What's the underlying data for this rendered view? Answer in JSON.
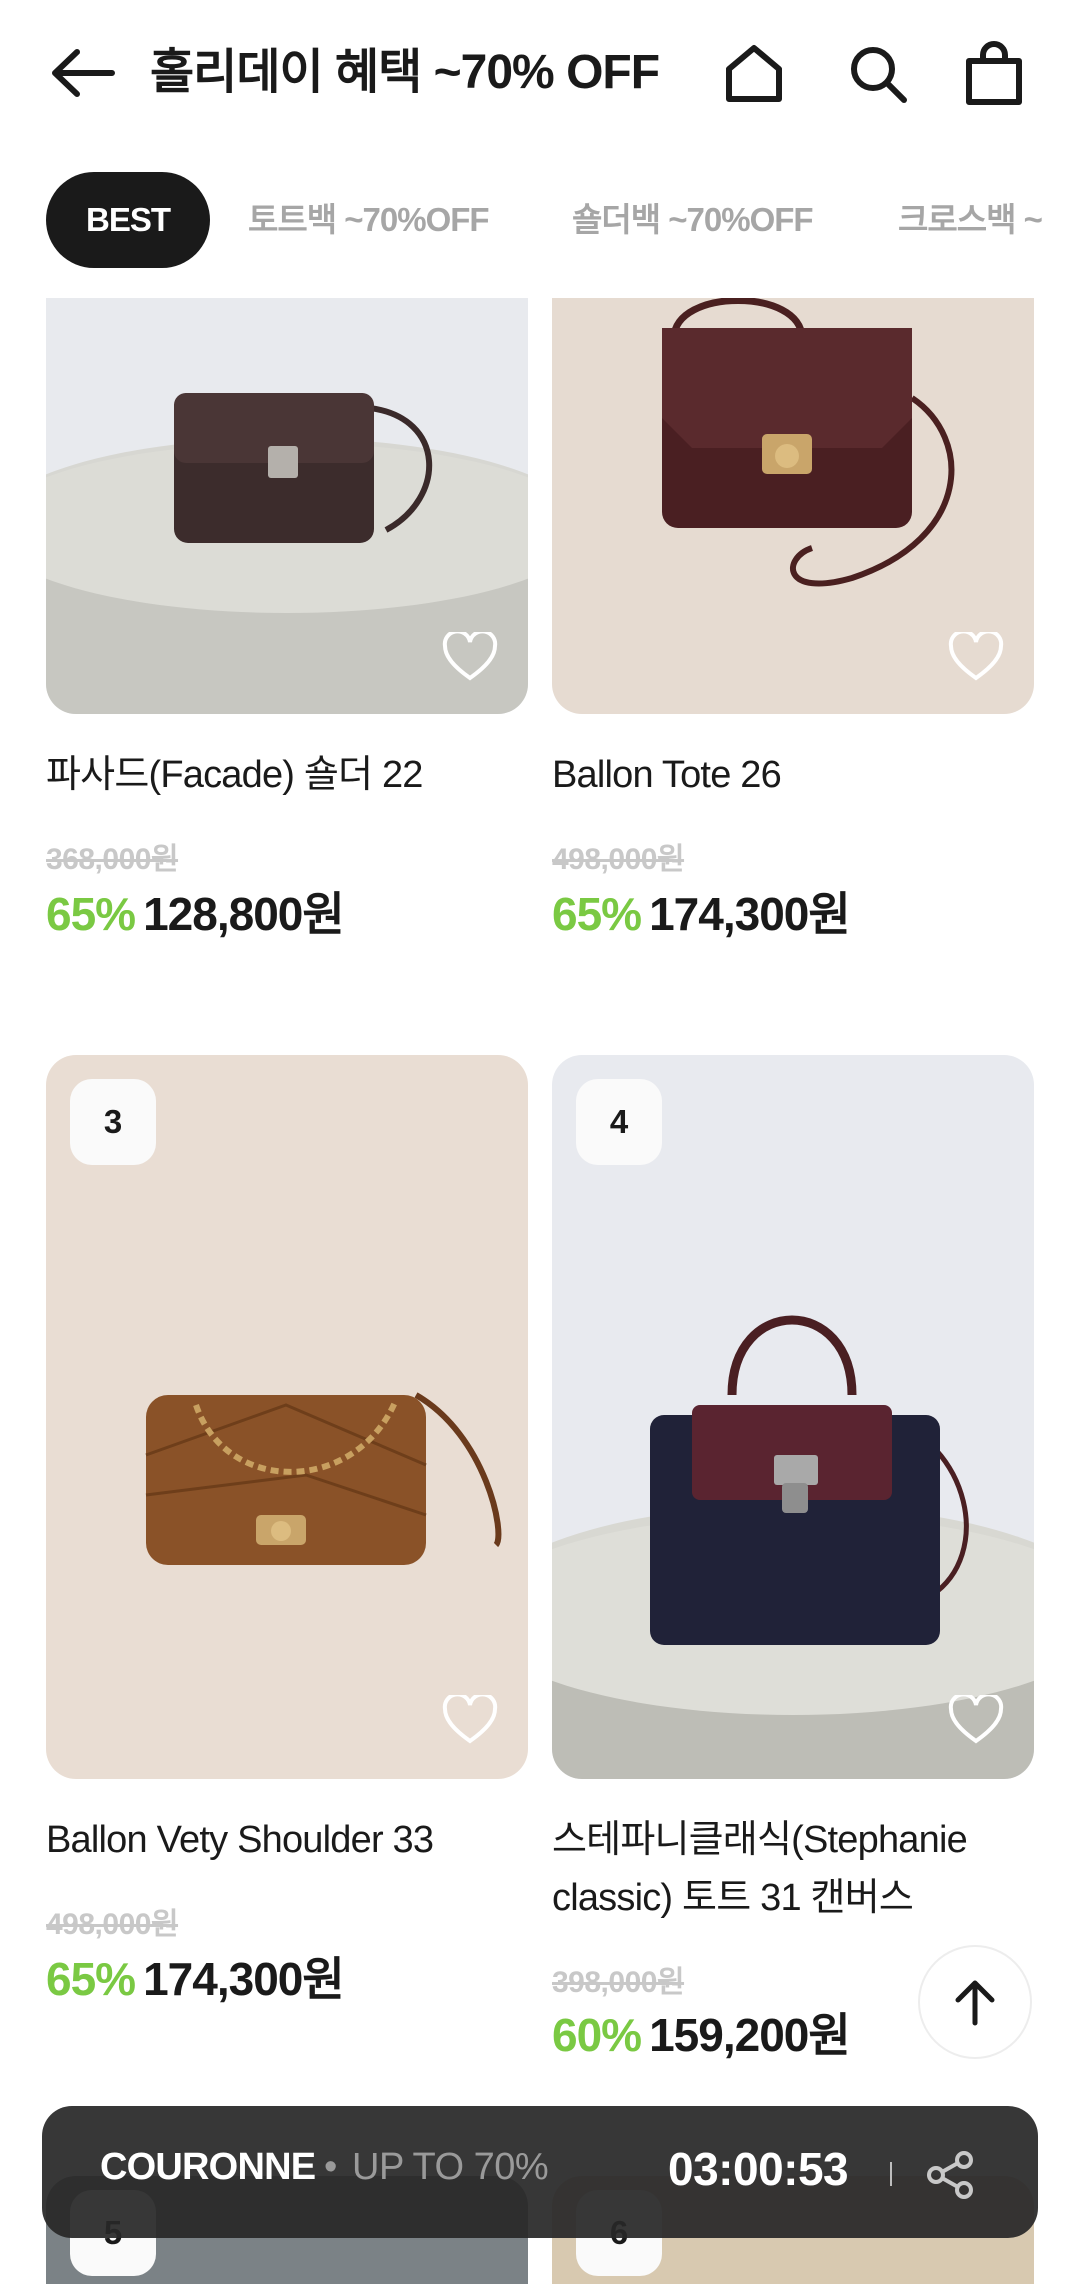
{
  "header": {
    "title": "홀리데이 혜택 ~70% OFF"
  },
  "tabs": [
    {
      "label": "BEST",
      "active": true
    },
    {
      "label": "토트백 ~70%OFF",
      "active": false
    },
    {
      "label": "숄더백 ~70%OFF",
      "active": false
    },
    {
      "label": "크로스백 ~",
      "active": false
    }
  ],
  "products": [
    {
      "rank": "",
      "name": "파사드(Facade) 숄더 22",
      "original_price": "368,000원",
      "discount": "65%",
      "price": "128,800원"
    },
    {
      "rank": "",
      "name": "Ballon Tote 26",
      "original_price": "498,000원",
      "discount": "65%",
      "price": "174,300원"
    },
    {
      "rank": "3",
      "name": "Ballon Vety Shoulder 33",
      "original_price": "498,000원",
      "discount": "65%",
      "price": "174,300원"
    },
    {
      "rank": "4",
      "name": "스테파니클래식(Stephanie classic) 토트 31 캔버스",
      "original_price": "398,000원",
      "discount": "60%",
      "price": "159,200원"
    },
    {
      "rank": "5"
    },
    {
      "rank": "6"
    }
  ],
  "banner": {
    "brand": "COURONNE",
    "separator": "•",
    "subtitle": "UP TO 70%",
    "timer": "03:00:53"
  },
  "colors": {
    "accent_discount": "#7ac943",
    "tab_active_bg": "#1a1a1a",
    "banner_bg": "#282828"
  },
  "icons": [
    "back-arrow-icon",
    "home-icon",
    "search-icon",
    "shopping-bag-icon",
    "heart-icon",
    "arrow-up-icon",
    "share-icon"
  ]
}
